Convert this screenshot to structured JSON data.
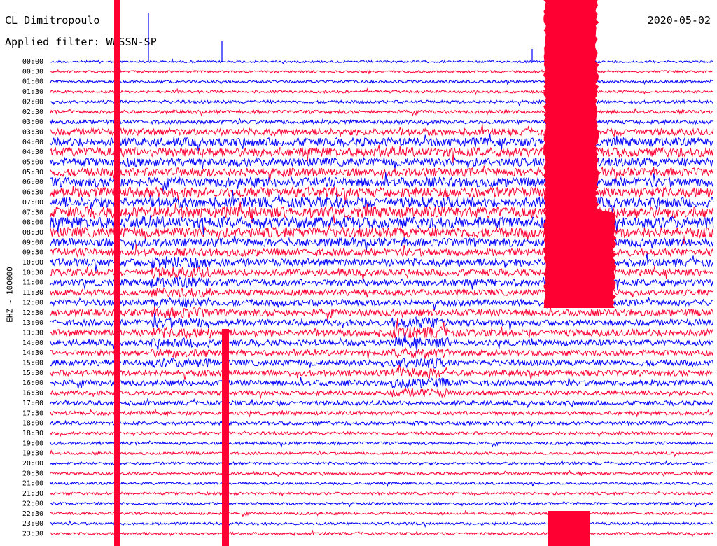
{
  "header": {
    "station": "CL Dimitropoulo",
    "date": "2020-05-02",
    "filter_label": "Applied filter: WWSSN-SP"
  },
  "chart_data": {
    "type": "line",
    "title": "CL Dimitropoulo",
    "ylabel": "EHZ - 100000",
    "row_labels": [
      "00:00",
      "00:30",
      "01:00",
      "01:30",
      "02:00",
      "02:30",
      "03:00",
      "03:30",
      "04:00",
      "04:30",
      "05:00",
      "05:30",
      "06:00",
      "06:30",
      "07:00",
      "07:30",
      "08:00",
      "08:30",
      "09:00",
      "09:30",
      "10:00",
      "10:30",
      "11:00",
      "11:30",
      "12:00",
      "12:30",
      "13:00",
      "13:30",
      "14:00",
      "14:30",
      "15:00",
      "15:30",
      "16:00",
      "16:30",
      "17:00",
      "17:30",
      "18:00",
      "18:30",
      "19:00",
      "19:30",
      "20:00",
      "20:30",
      "21:00",
      "21:30",
      "22:00",
      "22:30",
      "23:00",
      "23:30"
    ],
    "trace_colors": [
      "#0000ff",
      "#ff0033"
    ],
    "noise_level_per_row": [
      0.25,
      0.25,
      0.3,
      0.3,
      0.35,
      0.4,
      0.45,
      0.8,
      1.0,
      1.1,
      1.0,
      1.0,
      1.1,
      1.2,
      1.2,
      1.3,
      1.3,
      1.2,
      1.0,
      0.9,
      0.9,
      0.8,
      0.8,
      0.7,
      0.75,
      0.8,
      0.75,
      0.8,
      0.7,
      0.65,
      0.7,
      0.7,
      0.65,
      0.55,
      0.5,
      0.45,
      0.4,
      0.35,
      0.35,
      0.3,
      0.3,
      0.3,
      0.3,
      0.3,
      0.3,
      0.3,
      0.3,
      0.3
    ],
    "features": [
      {
        "name": "spike-band-1",
        "color": "#ff0033",
        "rows": "all"
      },
      {
        "name": "spike-band-2",
        "color": "#ff0033",
        "rows": "all"
      },
      {
        "name": "event-block",
        "color": "#ff0033",
        "rows": "00:00-12:30"
      }
    ]
  }
}
